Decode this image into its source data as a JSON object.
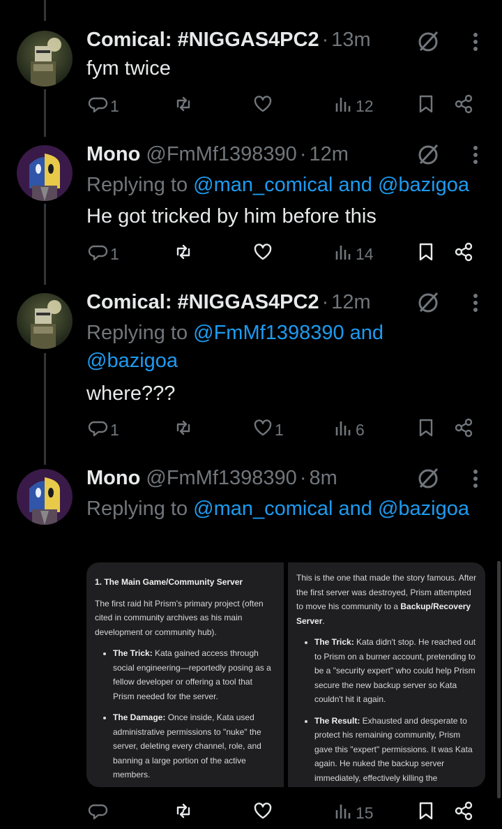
{
  "posts": [
    {
      "name": "Comical: #NIGGAS4PC2",
      "handle": "",
      "sep": "·",
      "time": "13m",
      "replying_prefix": "",
      "text": "fym twice",
      "replies": "1",
      "reposts": "",
      "likes": "",
      "views": "12"
    },
    {
      "name": "Mono",
      "handle": "@FmMf1398390",
      "sep": "·",
      "time": "12m",
      "replying_prefix": "Replying to ",
      "replying_users": [
        "@man_comical",
        "@bazigoa"
      ],
      "replying_and": " and ",
      "text": "He got tricked by him before this",
      "replies": "1",
      "reposts": "",
      "likes": "",
      "views": "14"
    },
    {
      "name": "Comical: #NIGGAS4PC2",
      "handle": "",
      "sep": "·",
      "time": "12m",
      "replying_prefix": "Replying to ",
      "replying_users": [
        "@FmMf1398390",
        "@bazigoa"
      ],
      "replying_and": " and",
      "text": "where???",
      "replies": "1",
      "reposts": "",
      "likes": "1",
      "views": "6"
    },
    {
      "name": "Mono",
      "handle": "@FmMf1398390",
      "sep": "·",
      "time": "8m",
      "replying_prefix": "Replying to ",
      "replying_users": [
        "@man_comical",
        "@bazigoa"
      ],
      "replying_and": " and ",
      "text": "",
      "replies": "",
      "reposts": "",
      "likes": "",
      "views": "15"
    }
  ],
  "media": {
    "left": {
      "title": "1. The Main Game/Community Server",
      "intro": "The first raid hit Prism's primary project (often cited in community archives as his main development or community hub).",
      "bullets": [
        {
          "label": "The Trick:",
          "text": " Kata gained access through social engineering—reportedly posing as a fellow developer or offering a tool that Prism needed for the server."
        },
        {
          "label": "The Damage:",
          "text": " Once inside, Kata used administrative permissions to \"nuke\" the server, deleting every channel, role, and banning a large portion of the active members."
        }
      ]
    },
    "right": {
      "intro_a": "This is the one that made the story famous. After the first server was destroyed, Prism attempted to move his community to a ",
      "intro_bold": "Backup/Recovery Server",
      "intro_b": ".",
      "bullets": [
        {
          "label": "The Trick:",
          "text": " Kata didn't stop. He reached out to Prism on a burner account, pretending to be a \"security expert\" who could help Prism secure the new backup server so Kata couldn't hit it again."
        },
        {
          "label": "The Result:",
          "text": " Exhausted and desperate to protect his remaining community, Prism gave this \"expert\" permissions. It was Kata again. He nuked the backup server immediately, effectively killing the"
        }
      ]
    }
  },
  "colors": {
    "background": "#000000",
    "text": "#e7e9ea",
    "muted": "#71767b",
    "link": "#1d9bf0",
    "panel": "#1f1f21"
  },
  "icons": [
    "reply-icon",
    "repost-icon",
    "like-icon",
    "views-icon",
    "bookmark-icon",
    "share-icon",
    "grok-icon",
    "more-icon"
  ]
}
